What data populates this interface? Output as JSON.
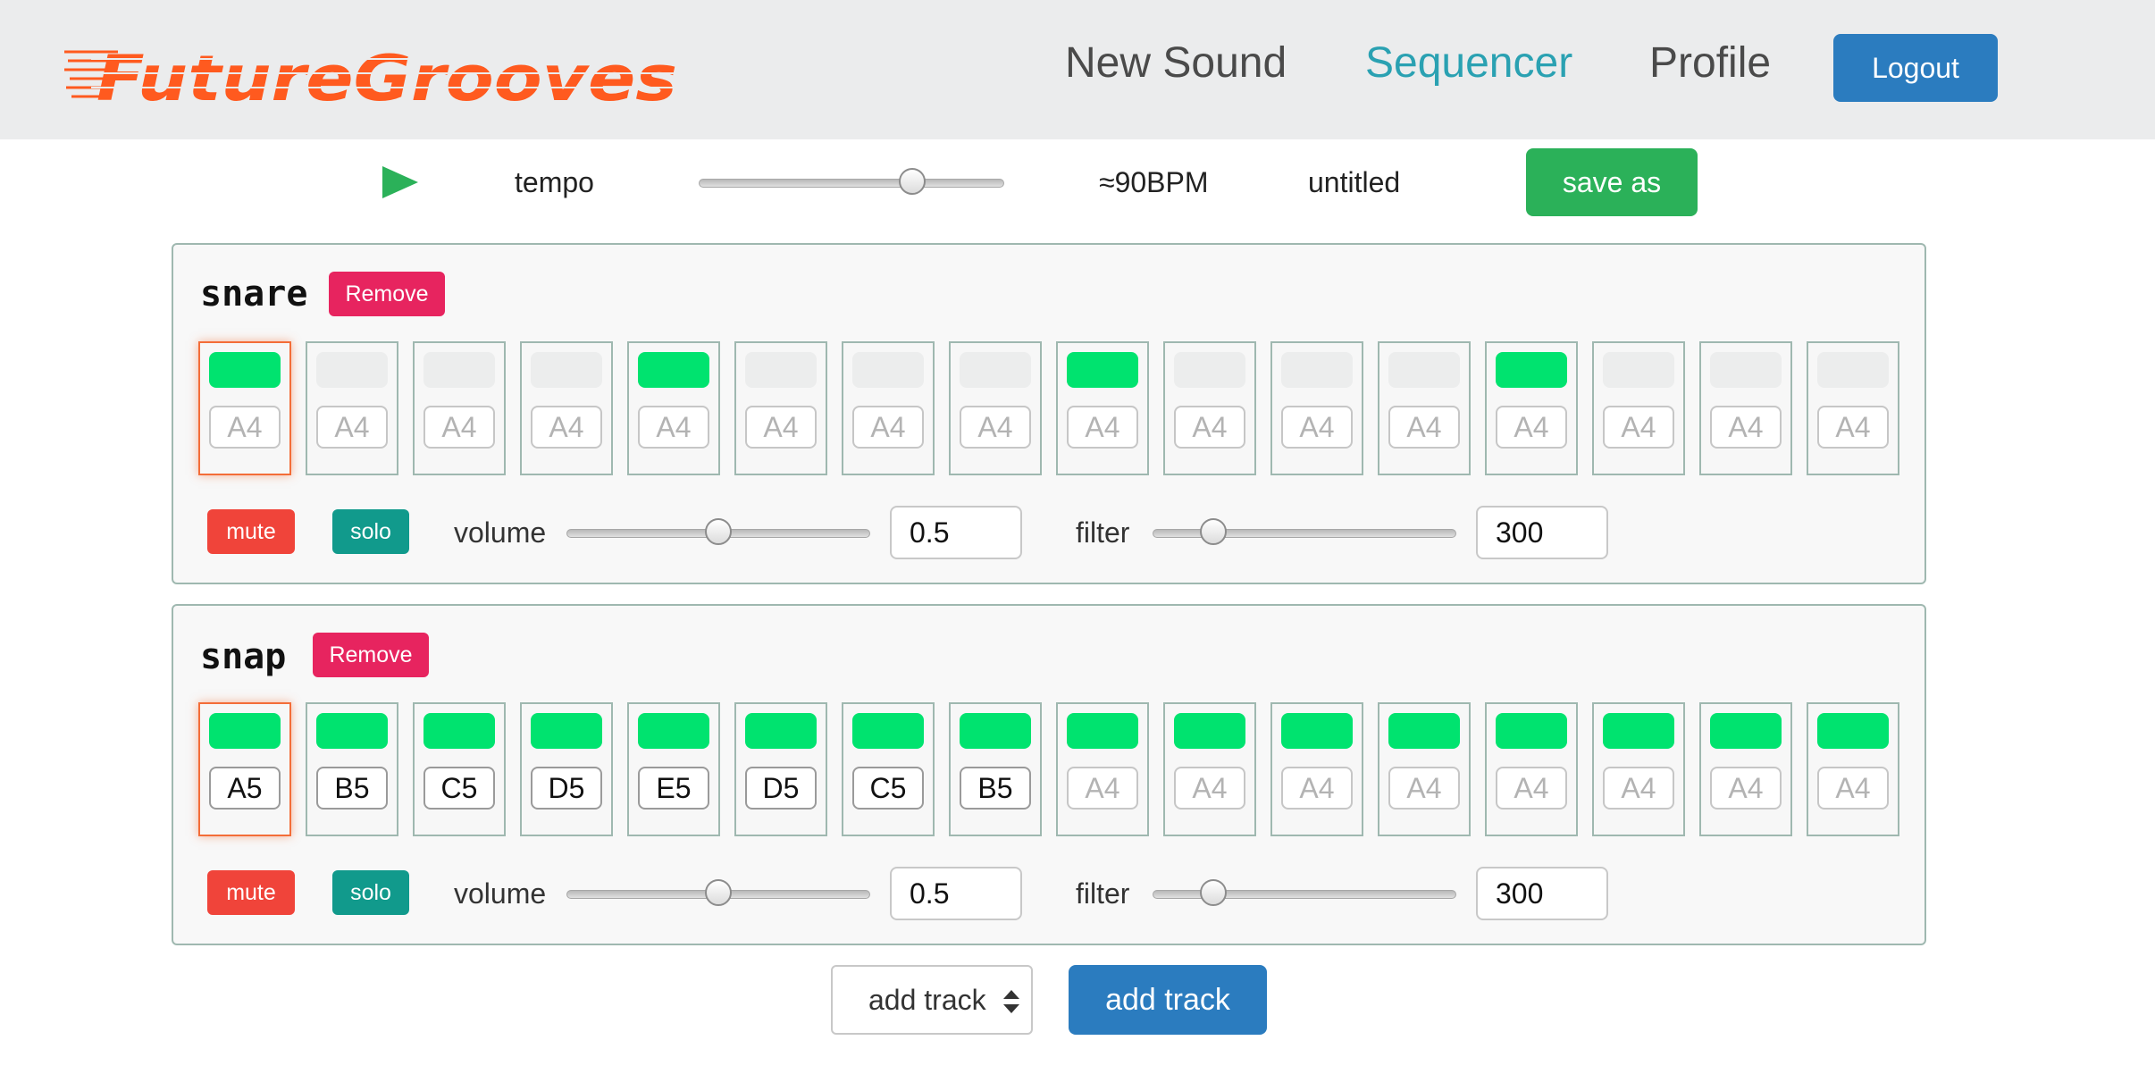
{
  "app": {
    "logo_text": "FutureGrooves",
    "nav": {
      "new_sound": "New Sound",
      "sequencer": "Sequencer",
      "profile": "Profile",
      "logout": "Logout"
    }
  },
  "transport": {
    "play_icon": "play-icon",
    "tempo_label": "tempo",
    "tempo_slider_fraction": 0.7,
    "bpm_display": "≈90BPM",
    "pattern_name": "untitled",
    "save_as_label": "save as"
  },
  "tracks": [
    {
      "name": "snare",
      "remove_label": "Remove",
      "mute_label": "mute",
      "solo_label": "solo",
      "volume_label": "volume",
      "volume_value": "0.5",
      "volume_slider_fraction": 0.5,
      "filter_label": "filter",
      "filter_value": "300",
      "filter_slider_fraction": 0.2,
      "current_step": 0,
      "steps": [
        {
          "on": true,
          "note": "A4",
          "set": false
        },
        {
          "on": false,
          "note": "A4",
          "set": false
        },
        {
          "on": false,
          "note": "A4",
          "set": false
        },
        {
          "on": false,
          "note": "A4",
          "set": false
        },
        {
          "on": true,
          "note": "A4",
          "set": false
        },
        {
          "on": false,
          "note": "A4",
          "set": false
        },
        {
          "on": false,
          "note": "A4",
          "set": false
        },
        {
          "on": false,
          "note": "A4",
          "set": false
        },
        {
          "on": true,
          "note": "A4",
          "set": false
        },
        {
          "on": false,
          "note": "A4",
          "set": false
        },
        {
          "on": false,
          "note": "A4",
          "set": false
        },
        {
          "on": false,
          "note": "A4",
          "set": false
        },
        {
          "on": true,
          "note": "A4",
          "set": false
        },
        {
          "on": false,
          "note": "A4",
          "set": false
        },
        {
          "on": false,
          "note": "A4",
          "set": false
        },
        {
          "on": false,
          "note": "A4",
          "set": false
        }
      ]
    },
    {
      "name": "snap",
      "remove_label": "Remove",
      "mute_label": "mute",
      "solo_label": "solo",
      "volume_label": "volume",
      "volume_value": "0.5",
      "volume_slider_fraction": 0.5,
      "filter_label": "filter",
      "filter_value": "300",
      "filter_slider_fraction": 0.2,
      "current_step": 0,
      "steps": [
        {
          "on": true,
          "note": "A5",
          "set": true
        },
        {
          "on": true,
          "note": "B5",
          "set": true
        },
        {
          "on": true,
          "note": "C5",
          "set": true
        },
        {
          "on": true,
          "note": "D5",
          "set": true
        },
        {
          "on": true,
          "note": "E5",
          "set": true
        },
        {
          "on": true,
          "note": "D5",
          "set": true
        },
        {
          "on": true,
          "note": "C5",
          "set": true
        },
        {
          "on": true,
          "note": "B5",
          "set": true
        },
        {
          "on": true,
          "note": "A4",
          "set": false
        },
        {
          "on": true,
          "note": "A4",
          "set": false
        },
        {
          "on": true,
          "note": "A4",
          "set": false
        },
        {
          "on": true,
          "note": "A4",
          "set": false
        },
        {
          "on": true,
          "note": "A4",
          "set": false
        },
        {
          "on": true,
          "note": "A4",
          "set": false
        },
        {
          "on": true,
          "note": "A4",
          "set": false
        },
        {
          "on": true,
          "note": "A4",
          "set": false
        }
      ]
    }
  ],
  "footer": {
    "select_value": "add track",
    "add_track_label": "add track"
  },
  "colors": {
    "accent_teal": "#2aa1b2",
    "logo_orange": "#ff5a1f",
    "step_on": "#00e36f",
    "remove": "#e7245f",
    "mute": "#f0443a",
    "solo": "#119a8c",
    "primary_blue": "#2b7cbf",
    "save_green": "#2bb159"
  }
}
